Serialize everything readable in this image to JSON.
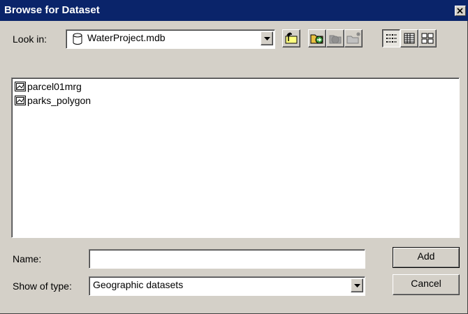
{
  "window": {
    "title": "Browse for Dataset"
  },
  "look_in": {
    "label": "Look in:",
    "value": "WaterProject.mdb",
    "icon": "database-icon"
  },
  "toolbar": {
    "buttons": [
      {
        "name": "up-one-level-icon"
      },
      {
        "name": "connect-folder-icon"
      },
      {
        "name": "disconnect-folder-icon"
      },
      {
        "name": "new-folder-icon"
      },
      {
        "name": "list-view-icon"
      },
      {
        "name": "details-view-icon"
      },
      {
        "name": "thumbnails-view-icon"
      }
    ]
  },
  "file_list": {
    "items": [
      {
        "name": "parcel01mrg",
        "icon": "feature-class-icon"
      },
      {
        "name": "parks_polygon",
        "icon": "feature-class-icon"
      }
    ]
  },
  "name_field": {
    "label": "Name:",
    "value": ""
  },
  "type_field": {
    "label": "Show of type:",
    "value": "Geographic datasets"
  },
  "buttons": {
    "add": "Add",
    "cancel": "Cancel"
  },
  "colors": {
    "titlebar": "#0a246a",
    "face": "#d4d0c8"
  }
}
